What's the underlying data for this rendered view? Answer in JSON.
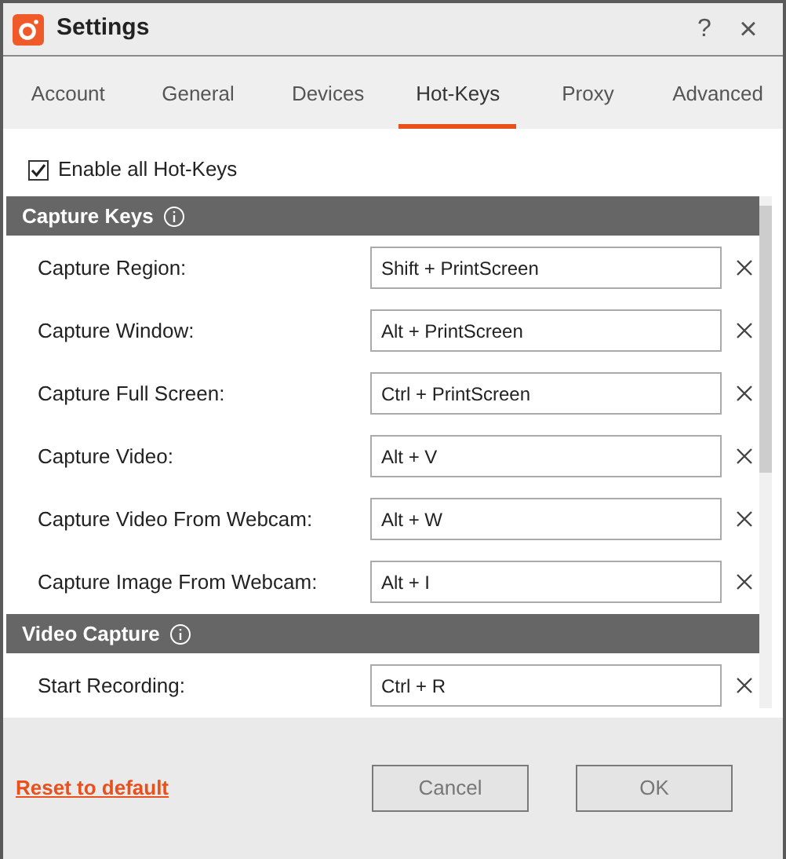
{
  "window": {
    "title": "Settings",
    "help": "?",
    "close": "×"
  },
  "tabs": [
    {
      "label": "Account",
      "selected": false
    },
    {
      "label": "General",
      "selected": false
    },
    {
      "label": "Devices",
      "selected": false
    },
    {
      "label": "Hot-Keys",
      "selected": true
    },
    {
      "label": "Proxy",
      "selected": false
    },
    {
      "label": "Advanced",
      "selected": false
    }
  ],
  "enable_all": {
    "label": "Enable all Hot-Keys",
    "checked": true
  },
  "sections": [
    {
      "title": "Capture Keys",
      "rows": [
        {
          "label": "Capture Region:",
          "value": "Shift + PrintScreen"
        },
        {
          "label": "Capture Window:",
          "value": "Alt + PrintScreen"
        },
        {
          "label": "Capture Full Screen:",
          "value": "Ctrl + PrintScreen"
        },
        {
          "label": "Capture Video:",
          "value": "Alt + V"
        },
        {
          "label": "Capture Video From Webcam:",
          "value": "Alt + W"
        },
        {
          "label": "Capture Image From Webcam:",
          "value": "Alt + I"
        }
      ]
    },
    {
      "title": "Video Capture",
      "rows": [
        {
          "label": "Start Recording:",
          "value": "Ctrl + R"
        }
      ]
    }
  ],
  "footer": {
    "reset_link": "Reset to default",
    "buttons": [
      "Cancel",
      "OK"
    ]
  }
}
